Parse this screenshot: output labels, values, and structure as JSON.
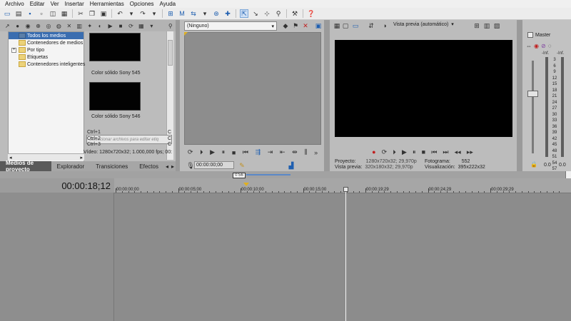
{
  "menu": [
    "Archivo",
    "Editar",
    "Ver",
    "Insertar",
    "Herramientas",
    "Opciones",
    "Ayuda"
  ],
  "media": {
    "tree": [
      {
        "label": "Todos los medios",
        "selected": true
      },
      {
        "label": "Contenedores de medios"
      },
      {
        "label": "Por tipo"
      },
      {
        "label": "Etiquetas"
      },
      {
        "label": "Contenedores inteligentes"
      }
    ],
    "thumbs": [
      {
        "label": "Color sólido Sony 545"
      },
      {
        "label": "Color sólido Sony 546"
      }
    ],
    "tag_placeholder": "Seleccionar archivos para editar etiq",
    "shortcuts": [
      {
        "key": "Ctrl+1",
        "val": "C"
      },
      {
        "key": "Ctrl+2",
        "val": "C"
      },
      {
        "key": "Ctrl+3",
        "val": "C"
      }
    ],
    "video_info": "Vídeo: 1280x720x32; 1.000,000 fps; 00:",
    "tabs": [
      "Medios de proyecto",
      "Explorador",
      "Transiciones",
      "Efectos"
    ]
  },
  "trimmer": {
    "dropdown": "(Ninguno)",
    "time": "00:00:00;00"
  },
  "preview": {
    "mode": "Vista previa (automático)",
    "info": {
      "proyecto_label": "Proyecto:",
      "proyecto_val": "1280x720x32; 29,970p",
      "vista_label": "Vista previa:",
      "vista_val": "320x180x32; 29,970p",
      "fotograma_label": "Fotograma:",
      "fotograma_val": "552",
      "visual_label": "Visualización:",
      "visual_val": "395x222x32"
    }
  },
  "mixer": {
    "title": "Master",
    "inf_left": "-Inf.",
    "inf_right": "-Inf.",
    "scale": [
      "3",
      "6",
      "9",
      "12",
      "15",
      "18",
      "21",
      "24",
      "27",
      "30",
      "33",
      "36",
      "39",
      "42",
      "45",
      "48",
      "51",
      "54",
      "57"
    ],
    "zero_left": "0.0",
    "zero_right": "0.0"
  },
  "timeline": {
    "timecode": "00:00:18;12",
    "loop_label": "0:56",
    "ticks": [
      "00:00:00;00",
      "00:00:05;00",
      "00:00:10;00",
      "00:00:15;00",
      "00:00:19;29",
      "00:00:24;29",
      "00:00:29;29"
    ]
  }
}
